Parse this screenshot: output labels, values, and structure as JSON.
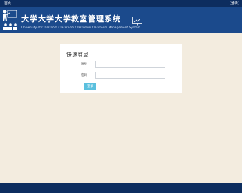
{
  "topbar": {
    "home_label": "首页",
    "back_label": "[登录]"
  },
  "banner": {
    "logo_icon": "classroom-teacher-icon",
    "title": "大学大学大学教室管理系统",
    "subtitle": "University of Classroom Classroom Classroom Classroom Management System",
    "board_icon": "presentation-board-icon"
  },
  "login": {
    "heading": "快速登录",
    "account_label": "账号",
    "account_value": "",
    "account_placeholder": "",
    "password_label": "密码",
    "password_value": "",
    "password_placeholder": "",
    "submit_label": "登录"
  },
  "colors": {
    "page_bg": "#f3ecdf",
    "topbar_bg": "#0d2d5f",
    "banner_bg": "#1b4a8c",
    "button_bg": "#5bc0de",
    "footer_bg": "#0d2d5f"
  }
}
